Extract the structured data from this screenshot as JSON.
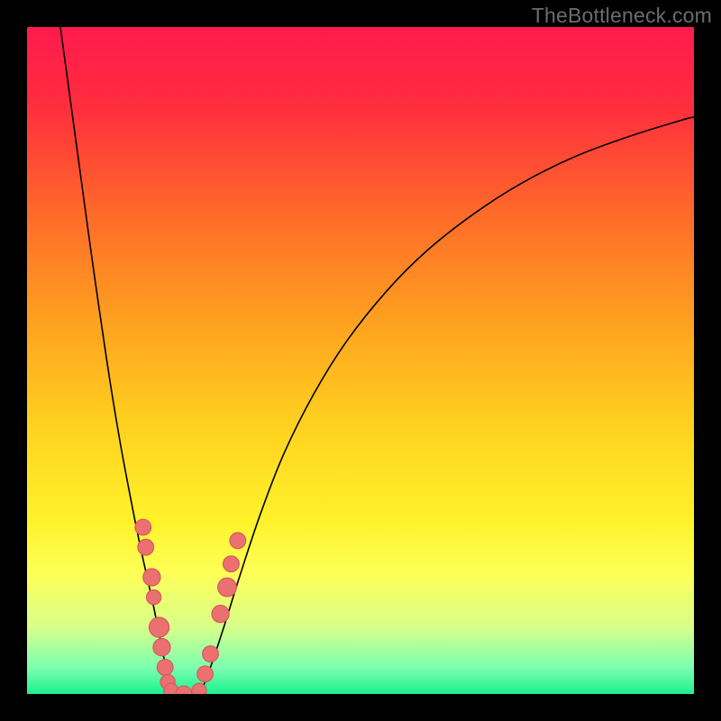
{
  "watermark": "TheBottleneck.com",
  "colors": {
    "black": "#000000",
    "curve": "#000000",
    "dot_fill": "#ec7070",
    "dot_stroke": "#cf5a5a"
  },
  "chart_data": {
    "type": "line",
    "title": "",
    "xlabel": "",
    "ylabel": "",
    "xlim": [
      0,
      100
    ],
    "ylim": [
      0,
      100
    ],
    "gradient_stops": [
      {
        "offset": 0.0,
        "color": "#ff1a4d"
      },
      {
        "offset": 0.12,
        "color": "#ff2e3e"
      },
      {
        "offset": 0.28,
        "color": "#ff6a2a"
      },
      {
        "offset": 0.45,
        "color": "#ffa41f"
      },
      {
        "offset": 0.6,
        "color": "#ffd21f"
      },
      {
        "offset": 0.74,
        "color": "#fff22a"
      },
      {
        "offset": 0.82,
        "color": "#fdff58"
      },
      {
        "offset": 0.9,
        "color": "#d7ff8a"
      },
      {
        "offset": 0.96,
        "color": "#7dffb0"
      },
      {
        "offset": 1.0,
        "color": "#1cf08f"
      }
    ],
    "series": [
      {
        "name": "left-branch",
        "x": [
          5.0,
          6.5,
          8.0,
          9.5,
          11.0,
          12.5,
          14.0,
          15.5,
          16.8,
          18.0,
          19.0,
          19.8,
          20.5,
          21.0,
          21.4
        ],
        "y": [
          100,
          89,
          78,
          67,
          56.5,
          46.5,
          37.5,
          29.5,
          23.0,
          17.5,
          13.0,
          9.0,
          5.5,
          2.5,
          0.5
        ]
      },
      {
        "name": "valley",
        "x": [
          21.4,
          22.0,
          23.0,
          24.0,
          25.0,
          26.0
        ],
        "y": [
          0.5,
          0.0,
          0.0,
          0.0,
          0.0,
          0.3
        ]
      },
      {
        "name": "right-branch",
        "x": [
          26.0,
          27.5,
          29.5,
          32.0,
          35.0,
          38.5,
          43.0,
          48.0,
          54.0,
          60.0,
          67.0,
          74.0,
          82.0,
          90.0,
          98.0,
          100.0
        ],
        "y": [
          0.3,
          4.0,
          10.0,
          18.0,
          27.0,
          36.0,
          45.0,
          53.0,
          60.5,
          66.5,
          72.0,
          76.5,
          80.5,
          83.5,
          86.0,
          86.5
        ]
      }
    ],
    "scatter": {
      "name": "highlight-dots",
      "points": [
        {
          "x": 17.4,
          "y": 25.0,
          "r": 1.2
        },
        {
          "x": 17.8,
          "y": 22.0,
          "r": 1.2
        },
        {
          "x": 18.7,
          "y": 17.5,
          "r": 1.3
        },
        {
          "x": 19.0,
          "y": 14.5,
          "r": 1.1
        },
        {
          "x": 19.8,
          "y": 10.0,
          "r": 1.5
        },
        {
          "x": 20.2,
          "y": 7.0,
          "r": 1.3
        },
        {
          "x": 20.7,
          "y": 4.0,
          "r": 1.2
        },
        {
          "x": 21.1,
          "y": 1.8,
          "r": 1.1
        },
        {
          "x": 21.6,
          "y": 0.5,
          "r": 1.1
        },
        {
          "x": 23.5,
          "y": 0.0,
          "r": 1.2
        },
        {
          "x": 25.8,
          "y": 0.5,
          "r": 1.1
        },
        {
          "x": 26.7,
          "y": 3.0,
          "r": 1.2
        },
        {
          "x": 27.5,
          "y": 6.0,
          "r": 1.2
        },
        {
          "x": 29.0,
          "y": 12.0,
          "r": 1.3
        },
        {
          "x": 30.0,
          "y": 16.0,
          "r": 1.4
        },
        {
          "x": 30.6,
          "y": 19.5,
          "r": 1.2
        },
        {
          "x": 31.6,
          "y": 23.0,
          "r": 1.2
        }
      ]
    }
  }
}
